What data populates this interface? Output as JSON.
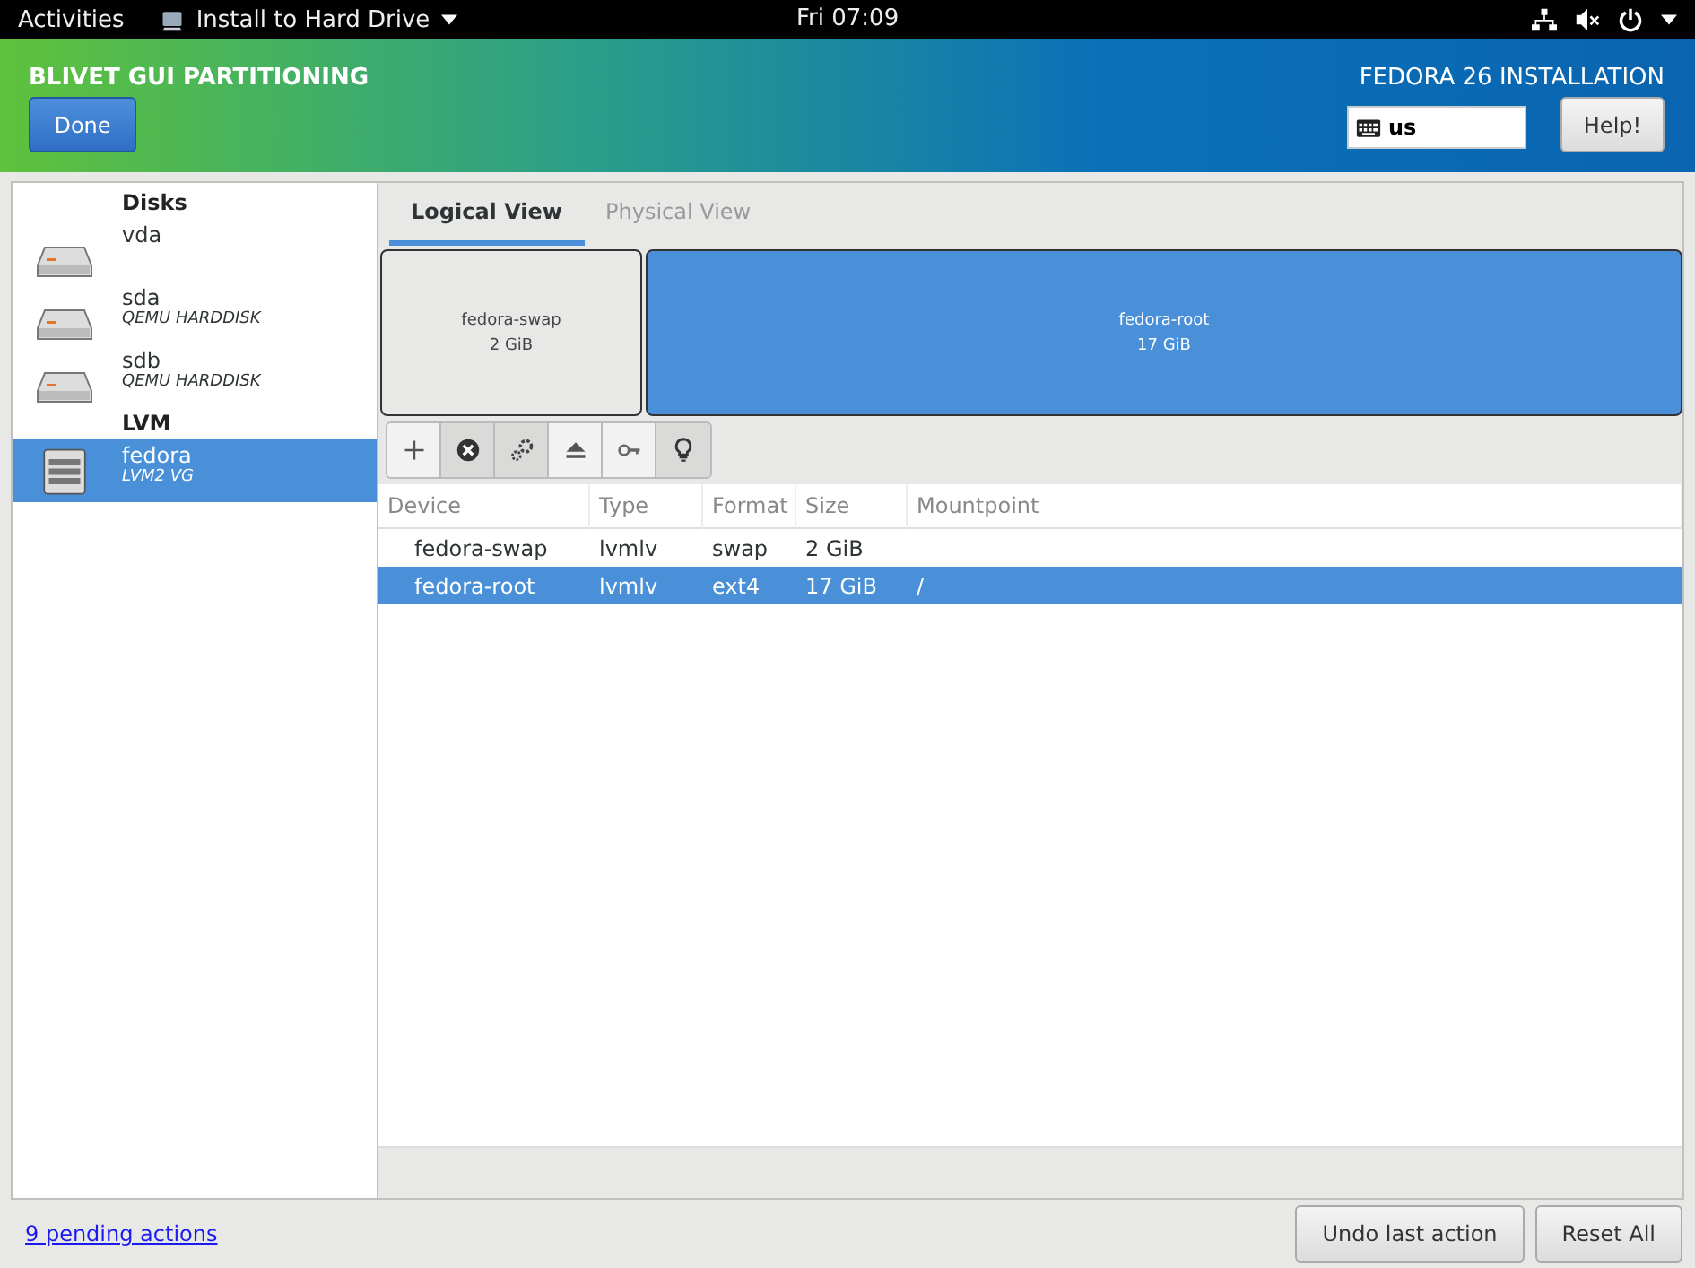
{
  "top_bar": {
    "activities": "Activities",
    "app_menu": "Install to Hard Drive",
    "clock": "Fri 07:09"
  },
  "header": {
    "title": "BLIVET GUI PARTITIONING",
    "done_button": "Done",
    "product": "FEDORA 26 INSTALLATION",
    "keyboard_layout": "us",
    "help_button": "Help!"
  },
  "sidebar": {
    "items": [
      {
        "kind": "heading",
        "label": "Disks"
      },
      {
        "kind": "disk",
        "label": "vda",
        "selected": false
      },
      {
        "kind": "disk",
        "label": "sda",
        "sublabel": "QEMU HARDDISK",
        "selected": false
      },
      {
        "kind": "disk",
        "label": "sdb",
        "sublabel": "QEMU HARDDISK",
        "selected": false
      },
      {
        "kind": "heading",
        "label": "LVM"
      },
      {
        "kind": "vg",
        "label": "fedora",
        "sublabel": "LVM2 VG",
        "selected": true
      }
    ]
  },
  "tabs": [
    {
      "label": "Logical View",
      "selected": true
    },
    {
      "label": "Physical View",
      "selected": false
    }
  ],
  "partitions": [
    {
      "name": "fedora-swap",
      "size": "2 GiB",
      "selected": false
    },
    {
      "name": "fedora-root",
      "size": "17 GiB",
      "selected": true
    }
  ],
  "toolbar": [
    {
      "kind": "add",
      "disabled": true
    },
    {
      "kind": "delete",
      "disabled": false
    },
    {
      "kind": "edit",
      "disabled": false
    },
    {
      "kind": "unmount",
      "disabled": true
    },
    {
      "kind": "decrypt",
      "disabled": true
    },
    {
      "kind": "info",
      "disabled": false
    }
  ],
  "table": {
    "columns": [
      "Device",
      "Type",
      "Format",
      "Size",
      "Mountpoint"
    ],
    "rows": [
      {
        "cells": [
          "fedora-swap",
          "lvmlv",
          "swap",
          "2 GiB",
          ""
        ],
        "selected": false
      },
      {
        "cells": [
          "fedora-root",
          "lvmlv",
          "ext4",
          "17 GiB",
          "/"
        ],
        "selected": true
      }
    ]
  },
  "footer": {
    "pending_link": "9 pending actions",
    "undo_button": "Undo last action",
    "reset_button": "Reset All"
  }
}
